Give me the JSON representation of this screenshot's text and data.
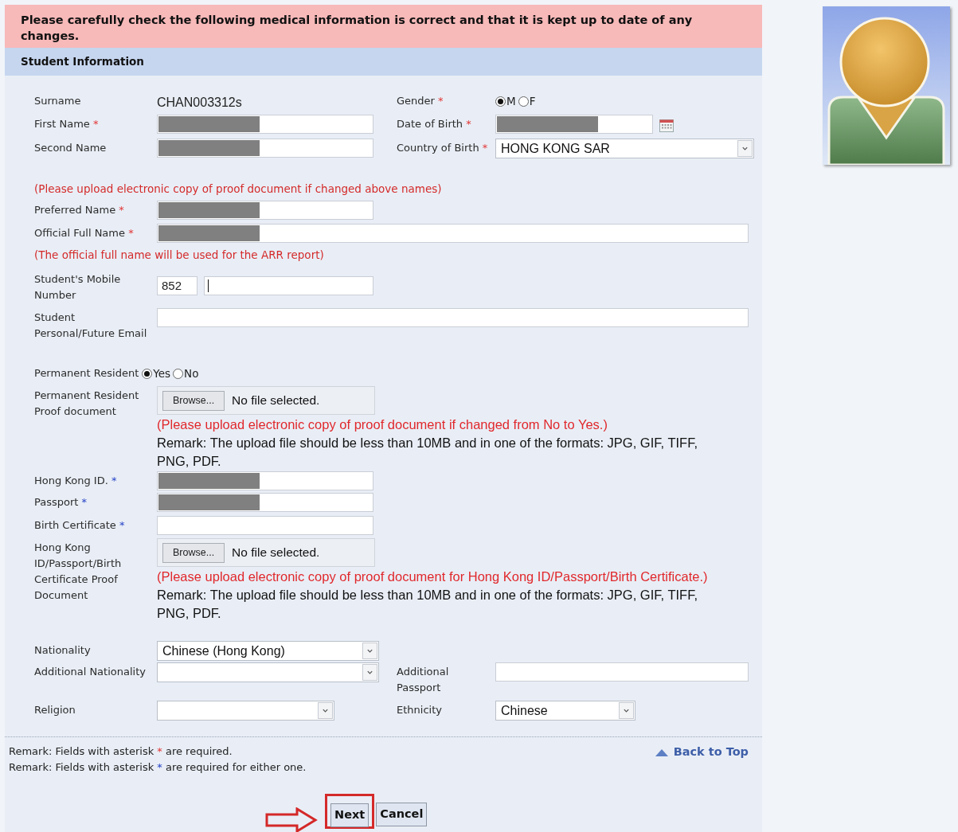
{
  "notice": "Please carefully check the following medical information is correct and that it is kept up to date of any changes.",
  "section_title": "Student Information",
  "rows": [
    {
      "left": {
        "kind": "text",
        "label": "Surname",
        "value": "CHAN003312s"
      },
      "right": {
        "kind": "radio",
        "label": "Gender",
        "asterisk": {
          "text": "*",
          "kind": "required"
        },
        "options": [
          {
            "label": "M",
            "selected": true
          },
          {
            "label": "F",
            "selected": false
          }
        ]
      }
    },
    {
      "left": {
        "kind": "input",
        "label": "First Name",
        "asterisk": {
          "text": "*",
          "kind": "required"
        },
        "redacted": true
      },
      "right": {
        "kind": "date",
        "label": "Date of Birth",
        "asterisk": {
          "text": "*",
          "kind": "required"
        },
        "redacted": true
      }
    },
    {
      "left": {
        "kind": "input",
        "label": "Second Name",
        "redacted": true
      },
      "right": {
        "kind": "select",
        "label": "Country of Birth",
        "asterisk": {
          "text": "*",
          "kind": "required"
        },
        "value": "HONG KONG SAR"
      }
    },
    {
      "left": {
        "kind": "note",
        "text": "(Please upload electronic copy of proof document if changed above names)"
      }
    },
    {
      "left": {
        "kind": "input",
        "label": "Preferred Name",
        "asterisk": {
          "text": "*",
          "kind": "required"
        },
        "redacted": true
      }
    },
    {
      "left": {
        "kind": "input",
        "label": "Official Full Name",
        "asterisk": {
          "text": "*",
          "kind": "required"
        },
        "redacted": true
      }
    },
    {
      "left": {
        "kind": "note",
        "text": "(The official full name will be used for the ARR report)"
      }
    },
    {
      "left": {
        "kind": "phone",
        "label": "Student's Mobile Number",
        "code": "852"
      }
    },
    {
      "left": {
        "kind": "input",
        "label": "Student Personal/Future Email",
        "redacted": false
      }
    },
    {
      "left": {
        "kind": "radio",
        "label": "Permanent Resident",
        "options": [
          {
            "label": "Yes",
            "selected": true
          },
          {
            "label": "No",
            "selected": false
          }
        ]
      }
    },
    {
      "left": {
        "kind": "file",
        "label": "Permanent Resident Proof document",
        "button": "Browse...",
        "status": "No file selected.",
        "note": "(Please upload electronic copy of proof document if changed from No to Yes.)",
        "remark": "Remark: The upload file should be less than 10MB and in one of the formats: JPG, GIF, TIFF, PNG, PDF."
      }
    },
    {
      "left": {
        "kind": "input",
        "label": "Hong Kong ID.",
        "asterisk": {
          "text": "*",
          "kind": "either"
        },
        "redacted": true
      }
    },
    {
      "left": {
        "kind": "input",
        "label": "Passport",
        "asterisk": {
          "text": "*",
          "kind": "either"
        },
        "redacted": true
      }
    },
    {
      "left": {
        "kind": "input",
        "label": "Birth Certificate",
        "asterisk": {
          "text": "*",
          "kind": "either"
        },
        "redacted": false
      }
    },
    {
      "left": {
        "kind": "file",
        "label": "Hong Kong ID/Passport/Birth Certificate Proof Document",
        "button": "Browse...",
        "status": "No file selected.",
        "note": "(Please upload electronic copy of proof document for Hong Kong ID/Passport/Birth Certificate.)",
        "remark": "Remark: The upload file should be less than 10MB and in one of the formats: JPG, GIF, TIFF, PNG, PDF."
      }
    },
    {
      "left": {
        "kind": "select",
        "label": "Nationality",
        "value": "Chinese (Hong Kong)"
      }
    },
    {
      "left": {
        "kind": "select",
        "label": "Additional Nationality"
      },
      "right": {
        "kind": "input",
        "label": "Additional Passport",
        "redacted": false
      }
    },
    {
      "left": {
        "kind": "select",
        "label": "Religion"
      },
      "right": {
        "kind": "select",
        "label": "Ethnicity",
        "value": "Chinese"
      }
    }
  ],
  "remarks": [
    {
      "before": "Remark: Fields with asterisk",
      "asterisk": "*",
      "kind": "required",
      "after": "are required."
    },
    {
      "before": "Remark: Fields with asterisk",
      "asterisk": "*",
      "kind": "either",
      "after": "are required for either one."
    }
  ],
  "back_to_top": "Back to Top",
  "buttons": [
    {
      "label": "Next",
      "highlighted": true
    },
    {
      "label": "Cancel",
      "highlighted": false
    }
  ]
}
